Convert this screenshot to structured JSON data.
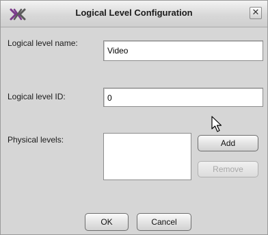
{
  "window": {
    "title": "Logical Level Configuration",
    "icons": {
      "app": "x-logo-icon",
      "close": "close-icon"
    },
    "close_glyph": "✕"
  },
  "form": {
    "name_label": "Logical level name:",
    "name_value": "Video",
    "id_label": "Logical level ID:",
    "id_value": "0",
    "physical_label": "Physical levels:",
    "physical_items": []
  },
  "buttons": {
    "add": "Add",
    "remove": "Remove",
    "ok": "OK",
    "cancel": "Cancel"
  },
  "colors": {
    "logo_accent": "#7a3a8a"
  }
}
